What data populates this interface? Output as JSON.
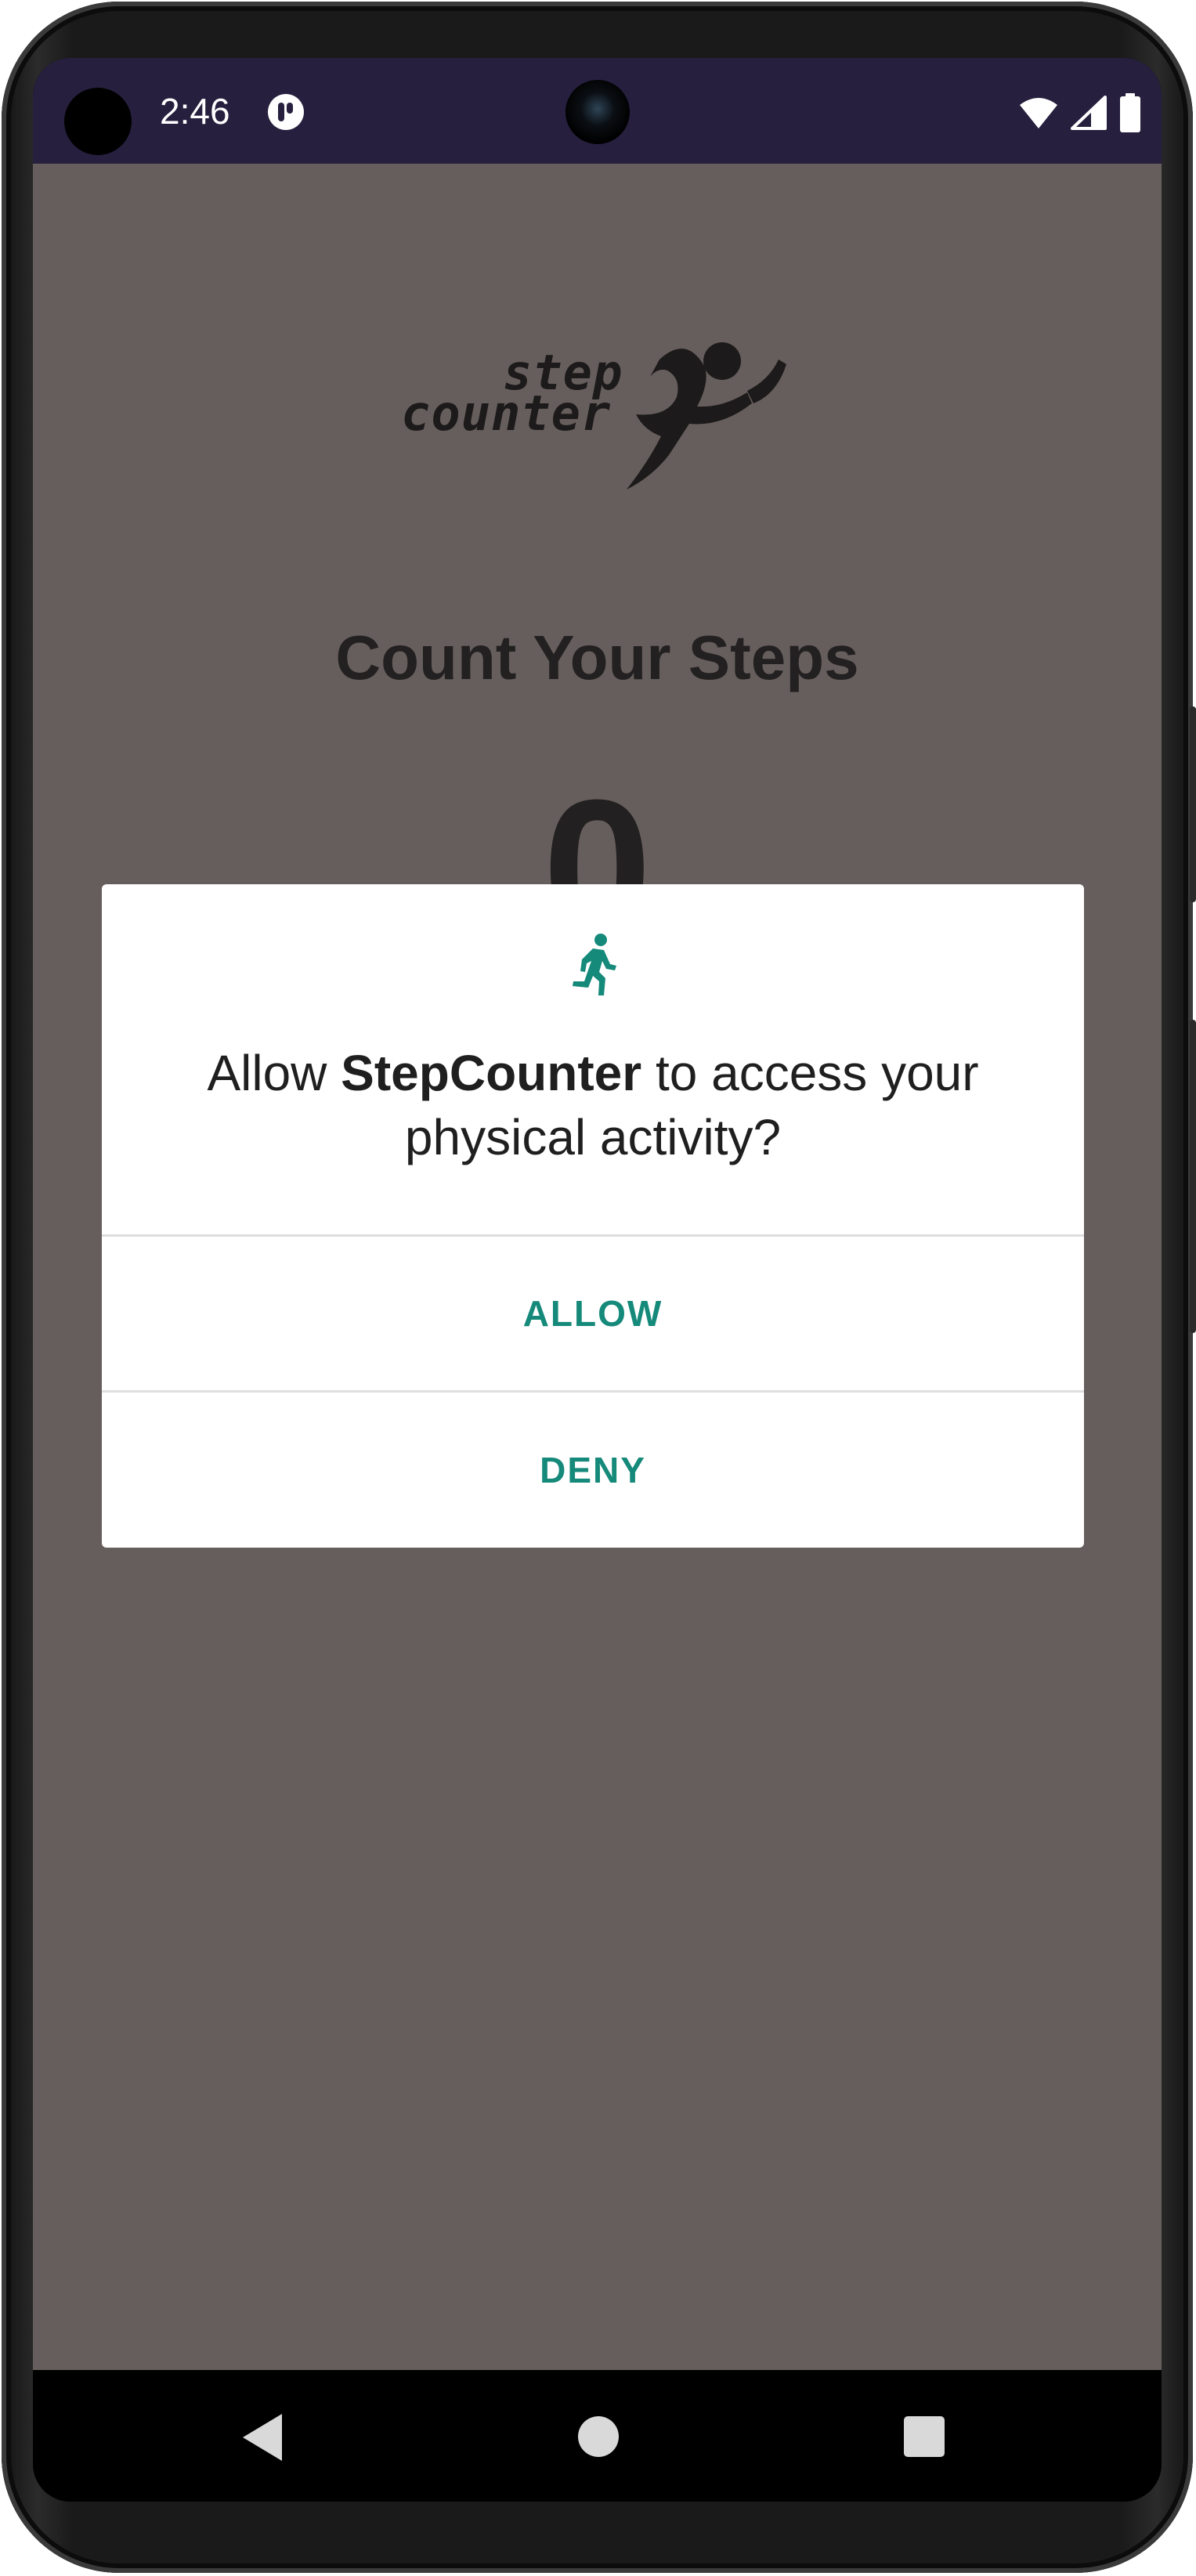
{
  "status_bar": {
    "time": "2:46",
    "icons": [
      "notification-app-icon",
      "wifi-icon",
      "cellular-signal-icon",
      "battery-icon"
    ],
    "background": "#261f3e"
  },
  "app": {
    "logo_line1": "step",
    "logo_line2": "counter",
    "title": "Count Your Steps",
    "step_count": "0",
    "background": "#665e5c"
  },
  "dialog": {
    "icon": "runner-icon",
    "message_prefix": "Allow ",
    "app_name": "StepCounter",
    "message_suffix": " to access your physical activity?",
    "allow_label": "ALLOW",
    "deny_label": "DENY",
    "accent": "#15897a"
  },
  "nav_bar": {
    "icons": [
      "back-icon",
      "home-icon",
      "recents-icon"
    ]
  }
}
